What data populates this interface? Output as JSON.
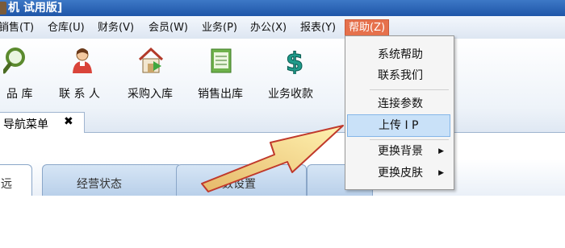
{
  "title": {
    "text": "机 试用版]"
  },
  "menu": {
    "items": [
      {
        "label": "销售(T)"
      },
      {
        "label": "仓库(U)"
      },
      {
        "label": "财务(V)"
      },
      {
        "label": "会员(W)"
      },
      {
        "label": "业务(P)"
      },
      {
        "label": "办公(X)"
      },
      {
        "label": "报表(Y)"
      },
      {
        "label": "帮助(Z)"
      }
    ]
  },
  "toolbar": {
    "items": [
      {
        "label": "品 库",
        "icon": "magnifier-icon"
      },
      {
        "label": "联 系 人",
        "icon": "contact-person-icon"
      },
      {
        "label": "采购入库",
        "icon": "purchase-house-icon"
      },
      {
        "label": "销售出库",
        "icon": "sales-book-icon"
      },
      {
        "label": "业务收款",
        "icon": "dollar-icon"
      }
    ]
  },
  "nav_tab": {
    "label": "导航菜单",
    "close": "✖"
  },
  "subtabs": [
    {
      "label": "远"
    },
    {
      "label": "经营状态"
    },
    {
      "label": "参数设置"
    },
    {
      "label": ""
    }
  ],
  "help_menu": {
    "items": [
      {
        "label": "系统帮助"
      },
      {
        "label": "联系我们"
      },
      {
        "label": "连接参数"
      },
      {
        "label": "上传 I P"
      },
      {
        "label": "更换背景"
      },
      {
        "label": "更换皮肤"
      }
    ],
    "highlighted": "上传 I P"
  },
  "colors": {
    "titlebar": "#1f56a8",
    "active_menu": "#e6714c",
    "arrow_fill": "#f3d27a",
    "arrow_outline": "#c0392b"
  }
}
